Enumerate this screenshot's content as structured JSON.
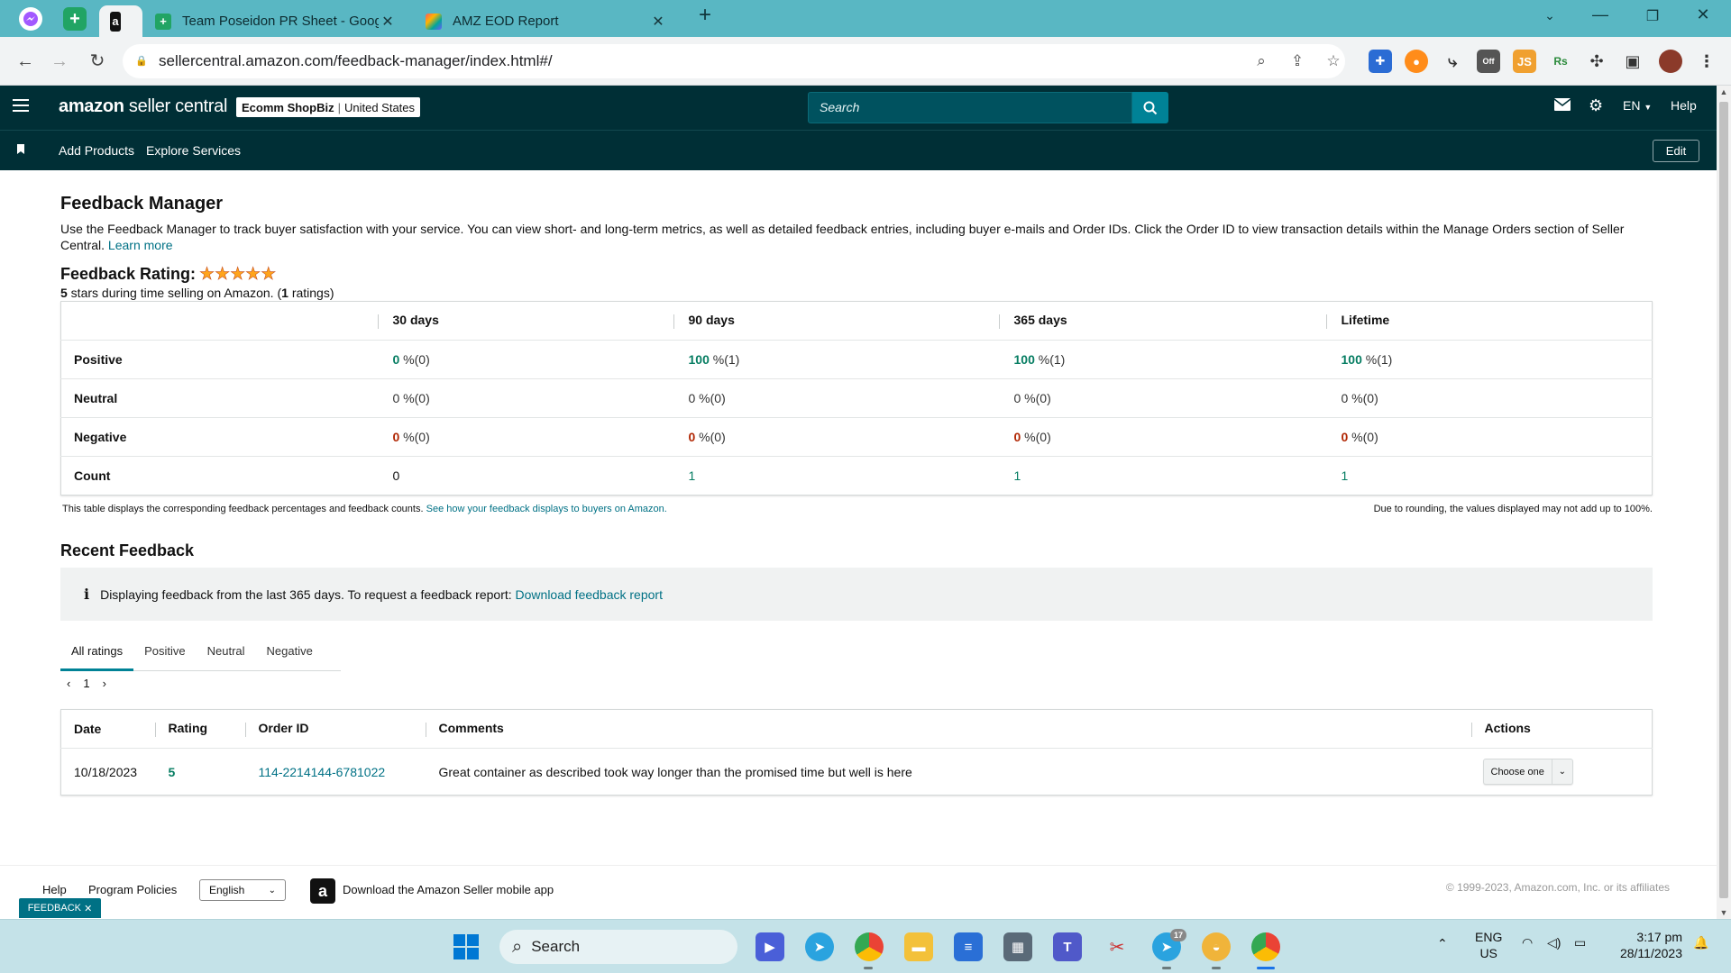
{
  "browser": {
    "tabs": [
      {
        "title": "Team Poseidon PR Sheet - Goog",
        "icon": "google-sheets-icon"
      },
      {
        "title": "AMZ EOD Report",
        "icon": "colorful-diamond-icon"
      }
    ],
    "url": "sellercentral.amazon.com/feedback-manager/index.html#/"
  },
  "header": {
    "brand_amazon": "amazon",
    "brand_rest": " seller central",
    "store_name": "Ecomm ShopBiz",
    "store_region": "United States",
    "search_placeholder": "Search",
    "language": "EN",
    "help": "Help",
    "nav": [
      "Add Products",
      "Explore Services"
    ],
    "edit": "Edit"
  },
  "page": {
    "title": "Feedback Manager",
    "intro": "Use the Feedback Manager to track buyer satisfaction with your service. You can view short- and long-term metrics, as well as detailed feedback entries, including buyer e-mails and Order IDs. Click the Order ID to view transaction details within the Manage Orders section of Seller Central.",
    "learn_more": "Learn more",
    "rating_label": "Feedback Rating:",
    "rating_stars": 5,
    "rating_sub_stars": "5",
    "rating_sub_mid": " stars during time selling on Amazon. (",
    "rating_sub_count": "1",
    "rating_sub_end": " ratings)"
  },
  "metrics": {
    "columns": [
      "30 days",
      "90 days",
      "365 days",
      "Lifetime"
    ],
    "rows": [
      {
        "label": "Positive",
        "values": [
          {
            "pct": "0",
            "cnt": " %(0)"
          },
          {
            "pct": "100",
            "cnt": " %(1)"
          },
          {
            "pct": "100",
            "cnt": " %(1)"
          },
          {
            "pct": "100",
            "cnt": " %(1)"
          }
        ]
      },
      {
        "label": "Neutral",
        "values": [
          {
            "pct": "0",
            "cnt": " %(0)"
          },
          {
            "pct": "0",
            "cnt": " %(0)"
          },
          {
            "pct": "0",
            "cnt": " %(0)"
          },
          {
            "pct": "0",
            "cnt": " %(0)"
          }
        ]
      },
      {
        "label": "Negative",
        "values": [
          {
            "pct": "0",
            "cnt": " %(0)"
          },
          {
            "pct": "0",
            "cnt": " %(0)"
          },
          {
            "pct": "0",
            "cnt": " %(0)"
          },
          {
            "pct": "0",
            "cnt": " %(0)"
          }
        ]
      },
      {
        "label": "Count",
        "values": [
          "0",
          "1",
          "1",
          "1"
        ]
      }
    ],
    "note_left": "This table displays the corresponding feedback percentages and feedback counts.",
    "note_link": "See how your feedback displays to buyers on Amazon.",
    "note_right": "Due to rounding, the values displayed may not add up to 100%."
  },
  "recent": {
    "title": "Recent Feedback",
    "info_text": "Displaying feedback from the last 365 days. To request a feedback report:",
    "info_link": "Download feedback report",
    "tabs": [
      "All ratings",
      "Positive",
      "Neutral",
      "Negative"
    ],
    "active_tab": "All ratings",
    "page": "1",
    "columns": [
      "Date",
      "Rating",
      "Order ID",
      "Comments",
      "Actions"
    ],
    "rows": [
      {
        "date": "10/18/2023",
        "rating": "5",
        "order_id": "114-2214144-6781022",
        "comment": "Great container as described took way longer than the promised time but well is here",
        "action": "Choose one"
      }
    ]
  },
  "footer": {
    "help": "Help",
    "policies": "Program Policies",
    "language": "English",
    "app_text": "Download the Amazon Seller mobile app",
    "copyright": "© 1999-2023, Amazon.com, Inc. or its affiliates",
    "feedback_tab": "FEEDBACK"
  },
  "taskbar": {
    "search": "Search",
    "lang_top": "ENG",
    "lang_bottom": "US",
    "time": "3:17 pm",
    "date": "28/11/2023",
    "telegram_badge": "17"
  }
}
